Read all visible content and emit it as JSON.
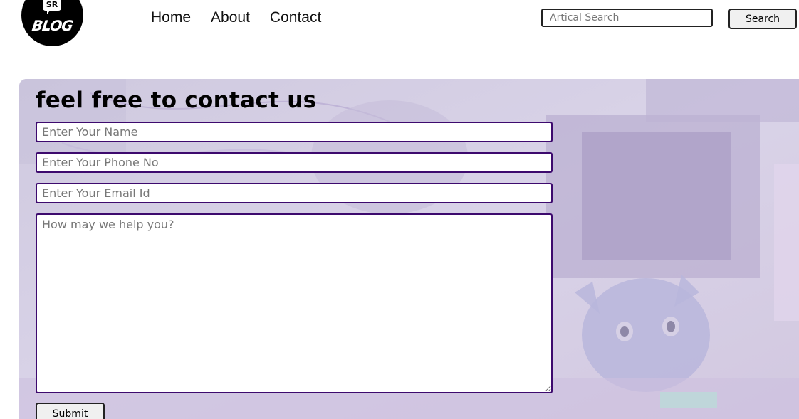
{
  "header": {
    "logo": {
      "badge_text": "SR",
      "word": "BLOG"
    },
    "nav": [
      {
        "label": "Home"
      },
      {
        "label": "About"
      },
      {
        "label": "Contact"
      }
    ],
    "search": {
      "placeholder": "Artical Search",
      "value": "",
      "button_label": "Search"
    }
  },
  "contact": {
    "title": "feel free to contact us",
    "name_placeholder": "Enter Your Name",
    "phone_placeholder": "Enter Your Phone No",
    "email_placeholder": "Enter Your Email Id",
    "message_placeholder": "How may we help you?",
    "submit_label": "Submit"
  },
  "colors": {
    "field_border": "#3d0a6e",
    "panel_tint": "#d8d3e6"
  }
}
